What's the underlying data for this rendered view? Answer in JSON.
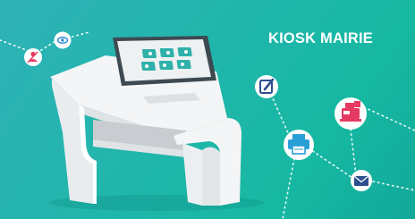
{
  "banner": {
    "headline": "KIOSK MAIRIE"
  },
  "palette": {
    "background_start": "#2fb2b7",
    "background_end": "#12a89a",
    "kiosk_body": "#f4f5f6",
    "kiosk_shadow": "#c9cdd1",
    "screen_frame": "#3e4a52",
    "screen_tiles": "#2fb1aa",
    "icon_pen_bg": "#2c4f8f",
    "icon_printer_bg": "#2a9fd6",
    "icon_mail_bg": "#2c4f8f",
    "icon_register_bg": "#e63a63",
    "icon_eye_bg": "#2c8fd6",
    "icon_user_bg": "#e63a63"
  },
  "icons": [
    "edit-document-icon",
    "printer-icon",
    "mail-icon",
    "cash-register-icon",
    "eye-icon",
    "user-icon"
  ]
}
